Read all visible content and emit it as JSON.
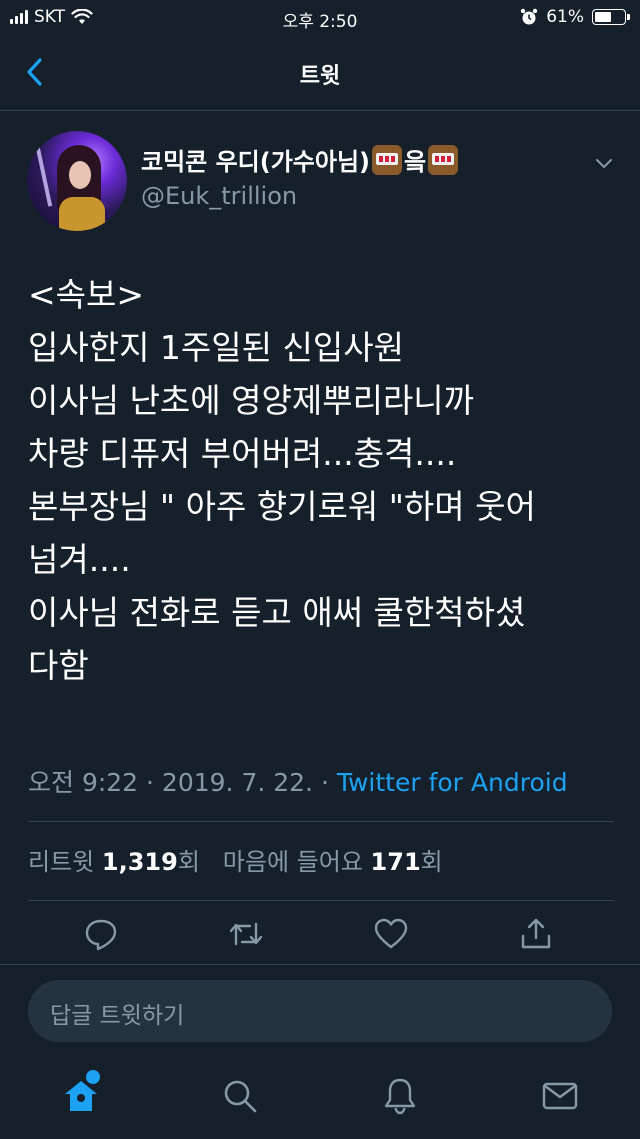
{
  "status_bar": {
    "carrier": "SKT",
    "time": "오후 2:50",
    "battery_percent": "61%",
    "battery_level": 0.61
  },
  "header": {
    "title": "트윗",
    "back_icon": "chevron-left-icon"
  },
  "tweet": {
    "display_name": "코믹콘 우디(가수아님)",
    "display_name_suffix": "읔",
    "name_emoji": "slot-machine-emoji",
    "handle": "@Euk_trillion",
    "text_lines": [
      "<속보>",
      "입사한지 1주일된 신입사원",
      "이사님 난초에 영양제뿌리라니까",
      "차량 디퓨저 부어버려...충격....",
      "본부장님 \" 아주 향기로워 \"하며 웃어",
      "넘겨....",
      "이사님 전화로 듣고 애써 쿨한척하셨",
      "다함"
    ],
    "timestamp": "오전 9:22 · 2019. 7. 22. · ",
    "source": "Twitter for Android",
    "retweets_label": "리트윗",
    "retweets_count": "1,319",
    "retweets_unit": "회",
    "likes_label": "마음에 들어요",
    "likes_count": "171",
    "likes_unit": "회"
  },
  "actions": [
    "reply-icon",
    "retweet-icon",
    "like-icon",
    "share-icon"
  ],
  "reply": {
    "placeholder": "답글 트윗하기"
  },
  "tab_bar": [
    "home-icon",
    "search-icon",
    "notifications-icon",
    "messages-icon"
  ],
  "colors": {
    "background": "#15202b",
    "accent": "#1da1f2",
    "secondary_text": "#8899a6",
    "divider": "#38444d"
  }
}
